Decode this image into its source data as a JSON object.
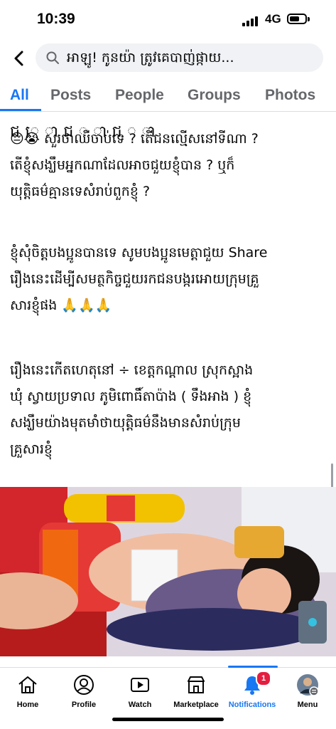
{
  "status": {
    "time": "10:39",
    "network": "4G"
  },
  "search": {
    "query": "អាឡូ! កូនយ៉ា ត្រូវគេបាញ់ផ្កាយ..."
  },
  "tabs": [
    {
      "label": "All"
    },
    {
      "label": "Posts"
    },
    {
      "label": "People"
    },
    {
      "label": "Groups"
    },
    {
      "label": "Photos"
    }
  ],
  "post": {
    "cut_line": "ជ ែ ា ជ ិ ា ជ ិ ា",
    "paragraphs": [
      {
        "lines": [
          "😔😭 សួរថាឈឺចាប់ទេ ? តើជនល្មើសនៅទីណា ?",
          "តើខ្ញុំសង្ឃឹមអ្នកណាដែលអាចជួយខ្ញុំបាន ? ឬក៏",
          "យុត្តិធម៌គ្មានទេសំរាប់ពួកខ្ញុំ ?"
        ]
      },
      {
        "lines": [
          "ខ្ញុំសុំចិត្តបងប្អូនបានទេ សូមបងប្អូនមេត្តាជួយ Share",
          "រឿងនេះដើម្បីសមត្ថកិច្ចជួយរកជនបង្ករអោយក្រុមគ្រួ",
          "សារខ្ញុំផង 🙏🙏🙏"
        ]
      },
      {
        "lines": [
          "រឿងនេះកើតហេតុនៅ ÷ ខេត្តកណ្តាល ស្រុកស្អាង",
          "ឃុំ ស្វាយប្រទាល ភូមិពោធិ៍តាប៉ាង ( ទឹងអាង ) ខ្ញុំ",
          "សង្ឃឹមយ៉ាងមុតមាំថាយុត្តិធម៌នឹងមានសំរាប់ក្រុម",
          "គ្រួសារខ្ញុំ"
        ]
      }
    ]
  },
  "nav": {
    "items": [
      {
        "label": "Home"
      },
      {
        "label": "Profile"
      },
      {
        "label": "Watch"
      },
      {
        "label": "Marketplace"
      },
      {
        "label": "Notifications",
        "badge": "1"
      },
      {
        "label": "Menu"
      }
    ]
  },
  "colors": {
    "accent": "#1877f2",
    "badge": "#e41e3f",
    "muted": "#65676b"
  }
}
